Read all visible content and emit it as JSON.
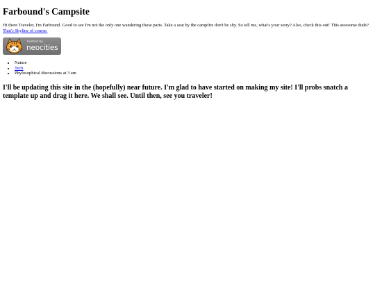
{
  "page": {
    "title": "Farbound's Campsite",
    "intro_text": "Hi there Traveler, I'm Farbound. Good to see I'm not the only one wandering those parts. Take a seat by the campfire don't be shy. So tell me, what's your story? Also, check this out! This awesome dude? ",
    "intro_link": "That's Skyline of course.",
    "badge": {
      "hosted_text": "hosted by",
      "brand_text": "neocities"
    },
    "links": [
      {
        "label": "Nature",
        "is_link": false
      },
      {
        "label": "Tech",
        "is_link": true
      },
      {
        "label": "Phylosophical discussions at 3 am",
        "is_link": false
      }
    ],
    "update_text": "I'll be updating this site in the (hopefully) near future. I'm glad to have started on making my site! I'll probs snatch a template up and drag it here. We shall see. Until then, see you traveler!"
  },
  "colors": {
    "link": "#0000ee",
    "badge_bg": "#7d7d7d",
    "cat_orange": "#f2a33a"
  },
  "icons": {
    "badge_mascot": "neocities-cat-icon"
  }
}
